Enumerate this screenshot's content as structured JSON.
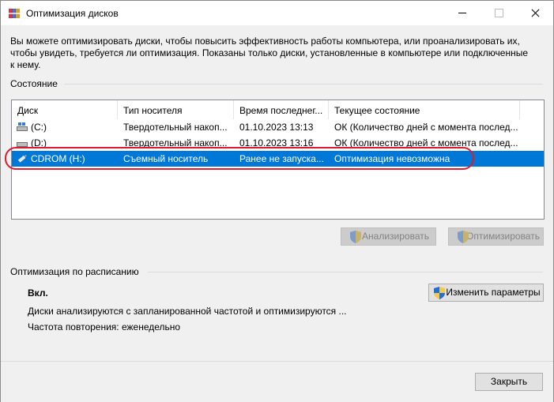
{
  "window": {
    "title": "Оптимизация дисков"
  },
  "description": "Вы можете оптимизировать диски, чтобы повысить эффективность работы  компьютера, или проанализировать их, чтобы увидеть, требуется ли оптимизация. Показаны только диски, установленные в компьютере или подключенные к нему.",
  "status": {
    "heading": "Состояние",
    "columns": [
      "Диск",
      "Тип носителя",
      "Время последнег...",
      "Текущее состояние"
    ],
    "rows": [
      {
        "disk": "(C:)",
        "media": "Твердотельный накоп...",
        "last": "01.10.2023 13:13",
        "state": "ОК (Количество дней с момента послед...",
        "icon": "hdd-icon"
      },
      {
        "disk": "(D:)",
        "media": "Твердотельный накоп...",
        "last": "01.10.2023 13:16",
        "state": "ОК (Количество дней с момента послед...",
        "icon": "hdd-icon"
      },
      {
        "disk": "CDROM (H:)",
        "media": "Съемный носитель",
        "last": "Ранее не запуска...",
        "state": "Оптимизация невозможна",
        "icon": "usb-drive-icon",
        "selected": true
      }
    ]
  },
  "actions": {
    "analyze": "Анализировать",
    "optimize": "Оптимизировать"
  },
  "schedule": {
    "heading": "Оптимизация по расписанию",
    "state": "Вкл.",
    "line1": "Диски анализируются с запланированной частотой и оптимизируются ...",
    "line2": "Частота повторения: еженедельно",
    "change_button": "Изменить параметры"
  },
  "footer": {
    "close_button": "Закрыть"
  },
  "colors": {
    "selection": "#0078d7",
    "annotation": "#e01a2a"
  }
}
